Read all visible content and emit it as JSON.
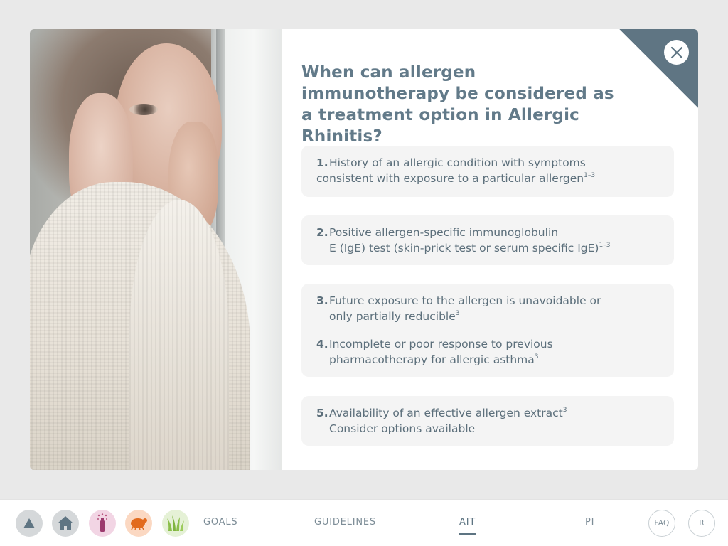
{
  "modal": {
    "heading": "When can allergen immunotherapy be considered as a treatment option in Allergic Rhinitis?",
    "items": [
      {
        "num": "1.",
        "line1": "History of an allergic condition with symptoms",
        "line2": "consistent with exposure to a particular allergen",
        "ref": "1–3"
      },
      {
        "num": "2.",
        "line1": "Positive allergen-specific immunoglobulin",
        "line2": "E (IgE) test (skin-prick test or serum specific IgE)",
        "ref": "1–3"
      },
      {
        "num": "3.",
        "line1": "Future exposure to the allergen is unavoidable or",
        "line2": "only partially reducible",
        "ref": "3"
      },
      {
        "num": "4.",
        "line1": "Incomplete or poor response to previous",
        "line2": "pharmacotherapy for allergic asthma",
        "ref": "3"
      },
      {
        "num": "5.",
        "line1": "Availability of an effective allergen extract",
        "line1_ref": "3",
        "line2": "Consider options available"
      }
    ],
    "close_icon": "close-icon",
    "colors": {
      "accent": "#5f7583",
      "heading": "#627a89",
      "card_bg": "#f4f4f4"
    }
  },
  "bottom_nav": {
    "icons": [
      {
        "name": "up-arrow-icon",
        "bg": "#d5d8da"
      },
      {
        "name": "home-icon",
        "bg": "#d5d8da"
      },
      {
        "name": "pollen-bottle-icon",
        "bg": "#f2d5e4"
      },
      {
        "name": "dust-mite-icon",
        "bg": "#fbd8c2"
      },
      {
        "name": "grass-icon",
        "bg": "#e5f1d6"
      }
    ],
    "links": {
      "goals": "GOALS",
      "guidelines": "GUIDELINES",
      "ait": "AIT",
      "pi": "PI"
    },
    "active": "AIT",
    "faq": "FAQ",
    "r": "R"
  }
}
